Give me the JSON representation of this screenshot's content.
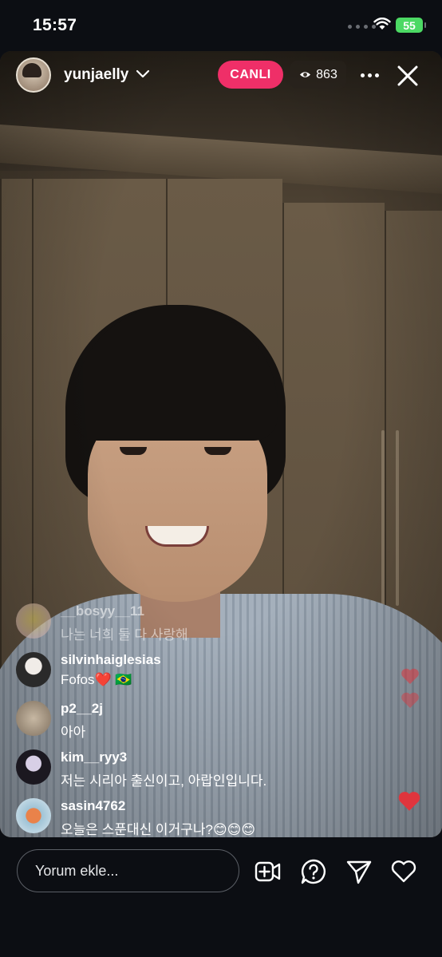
{
  "status_bar": {
    "time": "15:57",
    "battery": "55"
  },
  "header": {
    "username": "yunjaelly",
    "live_label": "CANLI",
    "viewer_count": "863"
  },
  "comments": [
    {
      "user": "__bosyy__11",
      "text": "나는 너희 둘 다 사랑해",
      "faded": true
    },
    {
      "user": "silvinhaiglesias",
      "text": "Fofos❤️ 🇧🇷"
    },
    {
      "user": "p2__2j",
      "text": "아아"
    },
    {
      "user": "kim__ryy3",
      "text": "저는 시리아 출신이고, 아랍인입니다."
    },
    {
      "user": "sasin4762",
      "text": "오늘은 스푼대신 이거구나?😊😊😊"
    }
  ],
  "composer": {
    "placeholder": "Yorum ekle..."
  },
  "icons": [
    "add-guest-icon",
    "question-icon",
    "send-icon",
    "heart-icon",
    "eye-icon",
    "more-icon",
    "close-icon",
    "chevron-down-icon",
    "wifi-icon"
  ],
  "colors": {
    "live_badge": "#ef2f68",
    "battery": "#4cd964",
    "background": "#0c0e13",
    "heart": "#e0353d"
  }
}
